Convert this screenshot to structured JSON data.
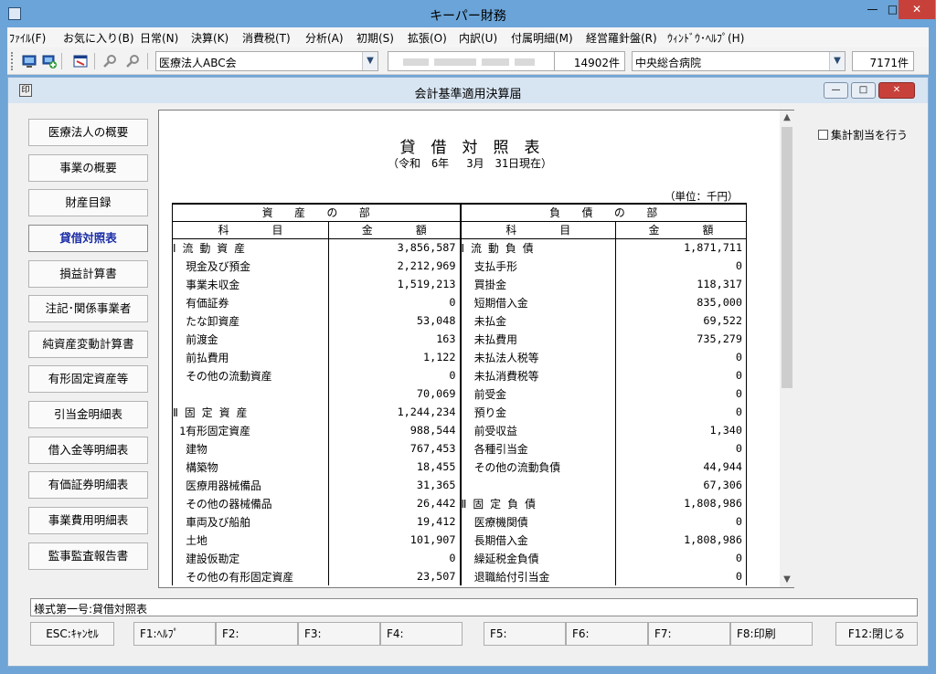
{
  "app": {
    "title": "キーパー財務"
  },
  "window_controls": {
    "minimize": "—",
    "maximize": "□",
    "close": "✕"
  },
  "menu": [
    "ﾌｧｲﾙ(F)",
    "お気に入り(B)",
    "日常(N)",
    "決算(K)",
    "消費税(T)",
    "分析(A)",
    "初期(S)",
    "拡張(O)",
    "内訳(U)",
    "付属明細(M)",
    "経営羅針盤(R)",
    "ｳｨﾝﾄﾞｳ･ﾍﾙﾌﾟ(H)"
  ],
  "toolbar": {
    "corporation": "医療法人ABC会",
    "corporation_count": "14902件",
    "facility": "中央総合病院",
    "facility_count": "7171件"
  },
  "inner_window": {
    "title": "会計基準適用決算届",
    "icon": "印"
  },
  "sidebar": [
    {
      "label": "医療法人の概要",
      "active": false
    },
    {
      "label": "事業の概要",
      "active": false
    },
    {
      "label": "財産目録",
      "active": false
    },
    {
      "label": "貸借対照表",
      "active": true
    },
    {
      "label": "損益計算書",
      "active": false
    },
    {
      "label": "注記･関係事業者",
      "active": false
    },
    {
      "label": "純資産変動計算書",
      "active": false
    },
    {
      "label": "有形固定資産等",
      "active": false
    },
    {
      "label": "引当金明細表",
      "active": false
    },
    {
      "label": "借入金等明細表",
      "active": false
    },
    {
      "label": "有価証券明細表",
      "active": false
    },
    {
      "label": "事業費用明細表",
      "active": false
    },
    {
      "label": "監事監査報告書",
      "active": false
    }
  ],
  "report": {
    "title": "貸　借　対　照　表",
    "date": "（令和　6年　 3月　31日現在）",
    "unit": "（単位：千円）",
    "header": {
      "assets": "資　　産　　の　　部",
      "liabilities": "負　　債　　の　　部",
      "subject": "科　　　　目",
      "amount": "金　　　　額"
    },
    "rows": [
      {
        "a_name": "Ⅰ 流 動 資 産",
        "a_amt": "3,856,587",
        "l_name": "Ⅰ 流 動 負 債",
        "l_amt": "1,871,711"
      },
      {
        "a_name": "  現金及び預金",
        "a_amt": "2,212,969",
        "l_name": "  支払手形",
        "l_amt": "0"
      },
      {
        "a_name": "  事業未収金",
        "a_amt": "1,519,213",
        "l_name": "  買掛金",
        "l_amt": "118,317"
      },
      {
        "a_name": "  有価証券",
        "a_amt": "0",
        "l_name": "  短期借入金",
        "l_amt": "835,000"
      },
      {
        "a_name": "  たな卸資産",
        "a_amt": "53,048",
        "l_name": "  未払金",
        "l_amt": "69,522"
      },
      {
        "a_name": "  前渡金",
        "a_amt": "163",
        "l_name": "  未払費用",
        "l_amt": "735,279"
      },
      {
        "a_name": "  前払費用",
        "a_amt": "1,122",
        "l_name": "  未払法人税等",
        "l_amt": "0"
      },
      {
        "a_name": "  その他の流動資産",
        "a_amt": "0",
        "l_name": "  未払消費税等",
        "l_amt": "0"
      },
      {
        "a_name": "",
        "a_amt": "70,069",
        "l_name": "  前受金",
        "l_amt": "0"
      },
      {
        "a_name": "Ⅱ 固 定 資 産",
        "a_amt": "1,244,234",
        "l_name": "  預り金",
        "l_amt": "0"
      },
      {
        "a_name": " 1有形固定資産",
        "a_amt": "988,544",
        "l_name": "  前受収益",
        "l_amt": "1,340"
      },
      {
        "a_name": "  建物",
        "a_amt": "767,453",
        "l_name": "  各種引当金",
        "l_amt": "0"
      },
      {
        "a_name": "  構築物",
        "a_amt": "18,455",
        "l_name": "  その他の流動負債",
        "l_amt": "44,944"
      },
      {
        "a_name": "  医療用器械備品",
        "a_amt": "31,365",
        "l_name": "",
        "l_amt": "67,306"
      },
      {
        "a_name": "  その他の器械備品",
        "a_amt": "26,442",
        "l_name": "Ⅱ 固 定 負 債",
        "l_amt": "1,808,986"
      },
      {
        "a_name": "  車両及び船舶",
        "a_amt": "19,412",
        "l_name": "  医療機関債",
        "l_amt": "0"
      },
      {
        "a_name": "  土地",
        "a_amt": "101,907",
        "l_name": "  長期借入金",
        "l_amt": "1,808,986"
      },
      {
        "a_name": "  建設仮勘定",
        "a_amt": "0",
        "l_name": "  繰延税金負債",
        "l_amt": "0"
      },
      {
        "a_name": "  その他の有形固定資産",
        "a_amt": "23,507",
        "l_name": "  退職給付引当金",
        "l_amt": "0"
      }
    ]
  },
  "checkbox": {
    "label": "集計割当を行う",
    "checked": false
  },
  "status": "様式第一号:貸借対照表",
  "fkeys": [
    {
      "label": "ESC:ｷｬﾝｾﾙ"
    },
    {
      "label": "F1:ﾍﾙﾌﾟ"
    },
    {
      "label": "F2:"
    },
    {
      "label": "F3:"
    },
    {
      "label": "F4:"
    },
    {
      "label": "F5:"
    },
    {
      "label": "F6:"
    },
    {
      "label": "F7:"
    },
    {
      "label": "F8:印刷"
    },
    {
      "label": "F12:閉じる"
    }
  ]
}
